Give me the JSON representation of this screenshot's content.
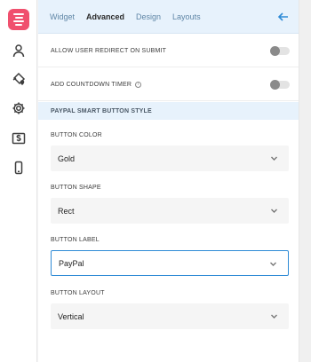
{
  "tabs": [
    {
      "label": "Widget"
    },
    {
      "label": "Advanced"
    },
    {
      "label": "Design"
    },
    {
      "label": "Layouts"
    }
  ],
  "active_tab": "Advanced",
  "toggles": [
    {
      "label": "ALLOW USER REDIRECT ON SUBMIT",
      "enabled": false
    },
    {
      "label": "ADD COUNTDOWN TIMER",
      "enabled": false,
      "info_icon": "info-icon"
    }
  ],
  "section": {
    "title": "PAYPAL SMART BUTTON STYLE"
  },
  "fields": [
    {
      "label": "BUTTON COLOR",
      "value": "Gold"
    },
    {
      "label": "BUTTON SHAPE",
      "value": "Rect"
    },
    {
      "label": "BUTTON LABEL",
      "value": "PayPal"
    },
    {
      "label": "BUTTON LAYOUT",
      "value": "Vertical"
    }
  ],
  "colors": {
    "accent": "#2f8bd6",
    "logo": "#f0506e",
    "header_bg": "#e7f2fc"
  },
  "rail_icons": [
    "forms-logo-icon",
    "user-icon",
    "paint-bucket-icon",
    "gear-icon",
    "dollar-icon",
    "mobile-icon"
  ]
}
